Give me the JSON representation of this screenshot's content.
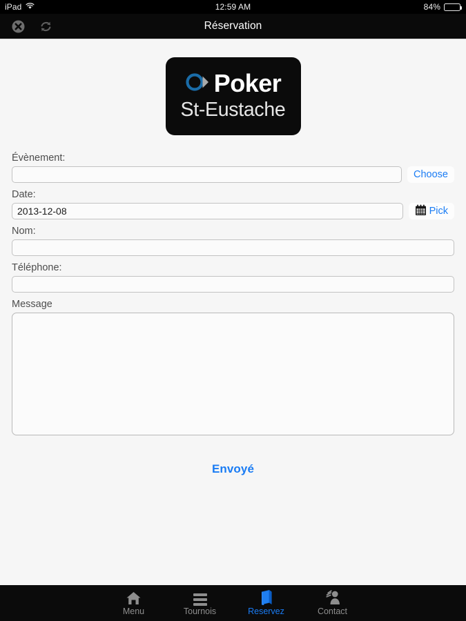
{
  "status_bar": {
    "device": "iPad",
    "wifi_icon": "wifi-icon",
    "time": "12:59 AM",
    "battery_percent": "84%",
    "battery_level": 84
  },
  "nav_bar": {
    "title": "Réservation",
    "close_icon": "close-circle-icon",
    "reload_icon": "reload-icon"
  },
  "logo": {
    "mark_icon": "poker-chip-chevron-icon",
    "title": "Poker",
    "subtitle": "St-Eustache",
    "background_color": "#0b0b0b",
    "mark_color": "#1a6ca8"
  },
  "form": {
    "event": {
      "label": "Évènement:",
      "value": "",
      "placeholder": "",
      "button_label": "Choose"
    },
    "date": {
      "label": "Date:",
      "value": "2013-12-08",
      "placeholder": "",
      "button_label": "Pick",
      "button_icon": "calendar-icon"
    },
    "name": {
      "label": "Nom:",
      "value": "",
      "placeholder": ""
    },
    "phone": {
      "label": "Téléphone:",
      "value": "",
      "placeholder": ""
    },
    "message": {
      "label": "Message",
      "value": "",
      "placeholder": ""
    },
    "submit_label": "Envoyé"
  },
  "tab_bar": {
    "accent_color": "#1a7cf4",
    "inactive_color": "#8e8e8e",
    "tabs": [
      {
        "label": "Menu",
        "icon": "home-icon",
        "active": false
      },
      {
        "label": "Tournois",
        "icon": "list-lines-icon",
        "active": false
      },
      {
        "label": "Reservez",
        "icon": "book-icon",
        "active": true
      },
      {
        "label": "Contact",
        "icon": "person-wave-icon",
        "active": false
      }
    ]
  }
}
